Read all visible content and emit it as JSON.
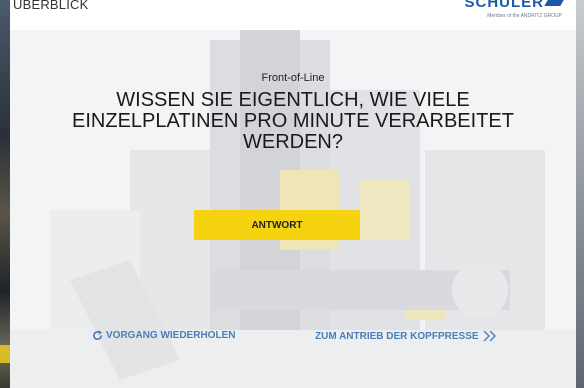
{
  "header": {
    "breadcrumb": "ÜBERBLICK",
    "logo_text": "SCHULER",
    "logo_sub": "Member of the ANDRITZ GROUP"
  },
  "main": {
    "subtitle": "Front-of-Line",
    "question": "WISSEN SIE EIGENTLICH, WIE VIELE EINZELPLATINEN PRO MINUTE VERARBEITET WERDEN?",
    "answer_button": "ANTWORT",
    "repeat_action": "VORGANG WIEDERHOLEN",
    "next_action": "ZUM ANTRIEB DER KOPFPRESSE"
  },
  "colors": {
    "accent_yellow": "#f5d310",
    "link_blue": "#4a7fb8",
    "brand_blue": "#1d5aa6"
  },
  "icons": {
    "repeat": "refresh-icon",
    "next": "double-chevron-right-icon"
  }
}
